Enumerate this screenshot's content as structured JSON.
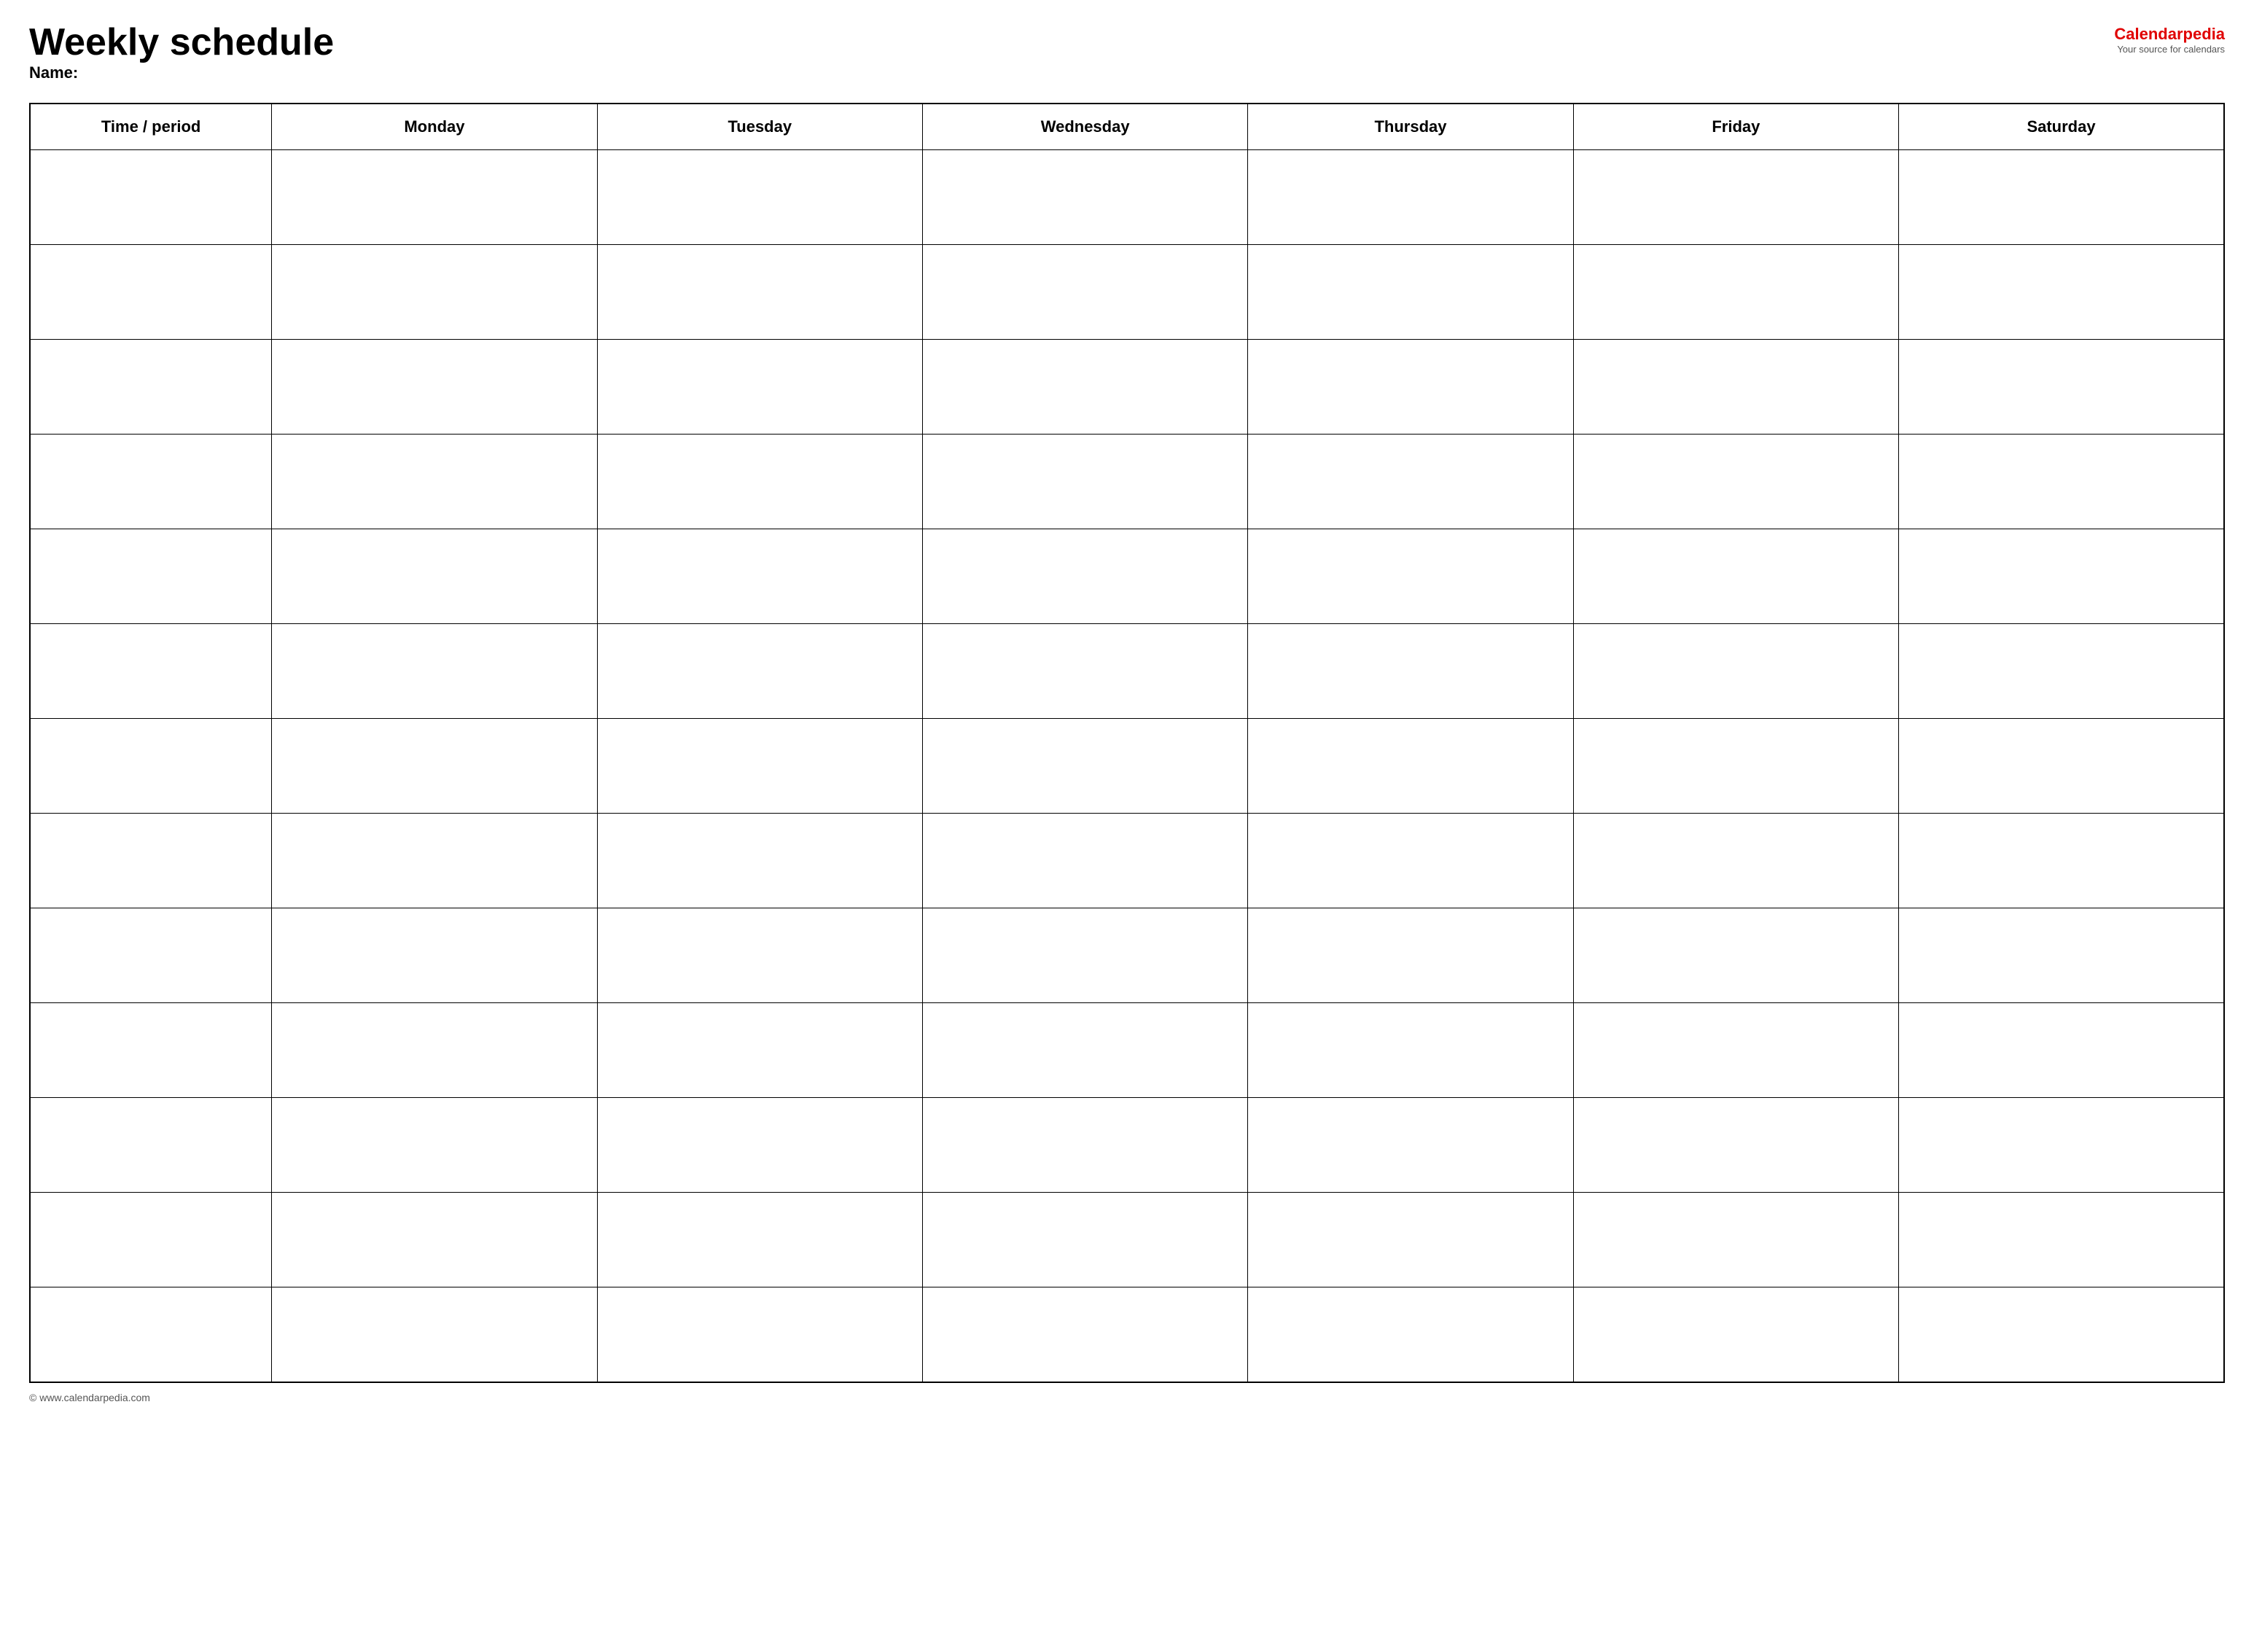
{
  "header": {
    "title": "Weekly schedule",
    "name_label": "Name:",
    "logo_text_before": "Calendar",
    "logo_text_accent": "pedia",
    "logo_subtitle": "Your source for calendars"
  },
  "table": {
    "columns": [
      {
        "label": "Time / period",
        "key": "time"
      },
      {
        "label": "Monday",
        "key": "monday"
      },
      {
        "label": "Tuesday",
        "key": "tuesday"
      },
      {
        "label": "Wednesday",
        "key": "wednesday"
      },
      {
        "label": "Thursday",
        "key": "thursday"
      },
      {
        "label": "Friday",
        "key": "friday"
      },
      {
        "label": "Saturday",
        "key": "saturday"
      }
    ],
    "rows": 13
  },
  "footer": {
    "text": "© www.calendarpedia.com"
  }
}
